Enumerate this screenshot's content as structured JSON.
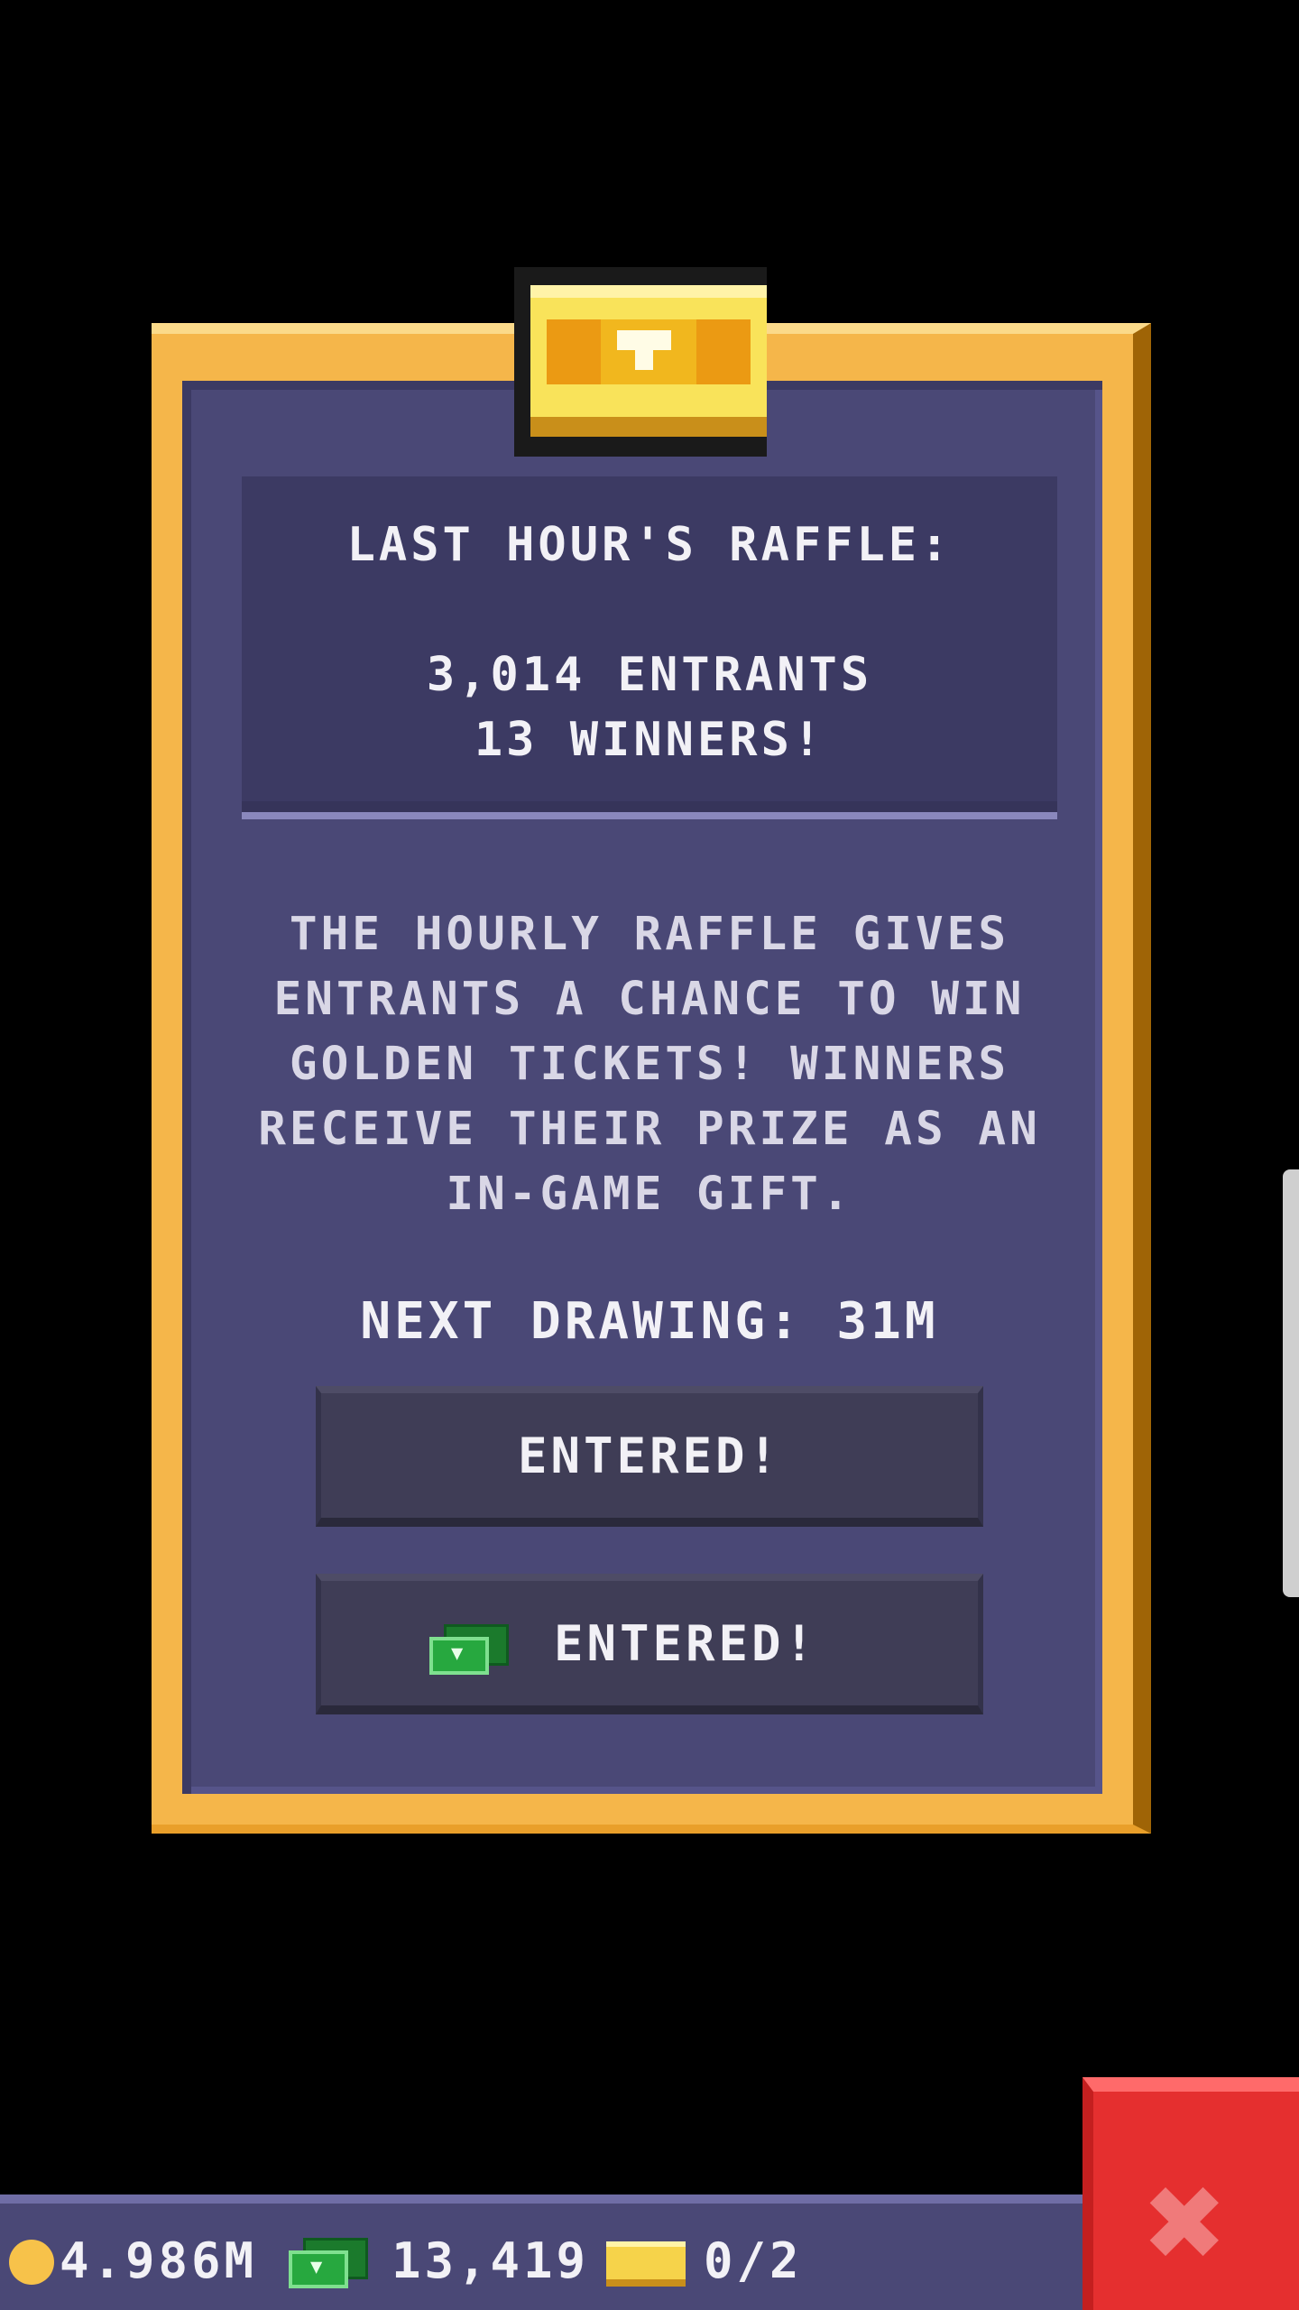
{
  "raffle": {
    "last_hour_title": "LAST HOUR'S RAFFLE:",
    "entrants": "3,014 ENTRANTS",
    "winners": "13 WINNERS!",
    "description": "THE HOURLY RAFFLE GIVES ENTRANTS A CHANCE TO WIN GOLDEN TICKETS! WINNERS RECEIVE THEIR PRIZE AS AN IN-GAME GIFT.",
    "next_drawing": "NEXT DRAWING: 31M",
    "free_entry_button": "ENTERED!",
    "paid_entry_button": "ENTERED!"
  },
  "currency_bar": {
    "coins": "4.986M",
    "cash": "13,419",
    "golden_tickets": "0/2"
  },
  "icons": {
    "header": "golden-ticket-icon",
    "paid_button": "cash-icon",
    "coins": "coin-icon",
    "cash": "cash-icon",
    "tickets": "golden-ticket-icon",
    "close": "close-icon"
  },
  "colors": {
    "frame_gold": "#f5b64a",
    "panel_purple": "#4a4876",
    "close_red": "#e52f2f",
    "cash_green": "#27a83f"
  }
}
